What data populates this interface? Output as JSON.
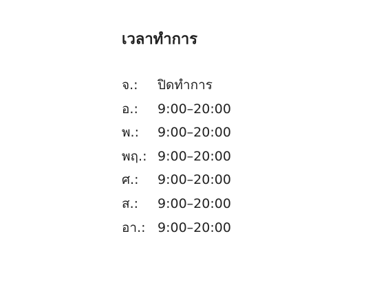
{
  "opening_hours": {
    "title": "เวลาทำการ",
    "rows": [
      {
        "day": "จ.:",
        "hours": "ปิดทำการ"
      },
      {
        "day": "อ.:",
        "hours": "9:00–20:00"
      },
      {
        "day": "พ.:",
        "hours": "9:00–20:00"
      },
      {
        "day": "พฤ.:",
        "hours": "9:00–20:00"
      },
      {
        "day": "ศ.:",
        "hours": "9:00–20:00"
      },
      {
        "day": "ส.:",
        "hours": "9:00–20:00"
      },
      {
        "day": "อา.:",
        "hours": "9:00–20:00"
      }
    ]
  }
}
